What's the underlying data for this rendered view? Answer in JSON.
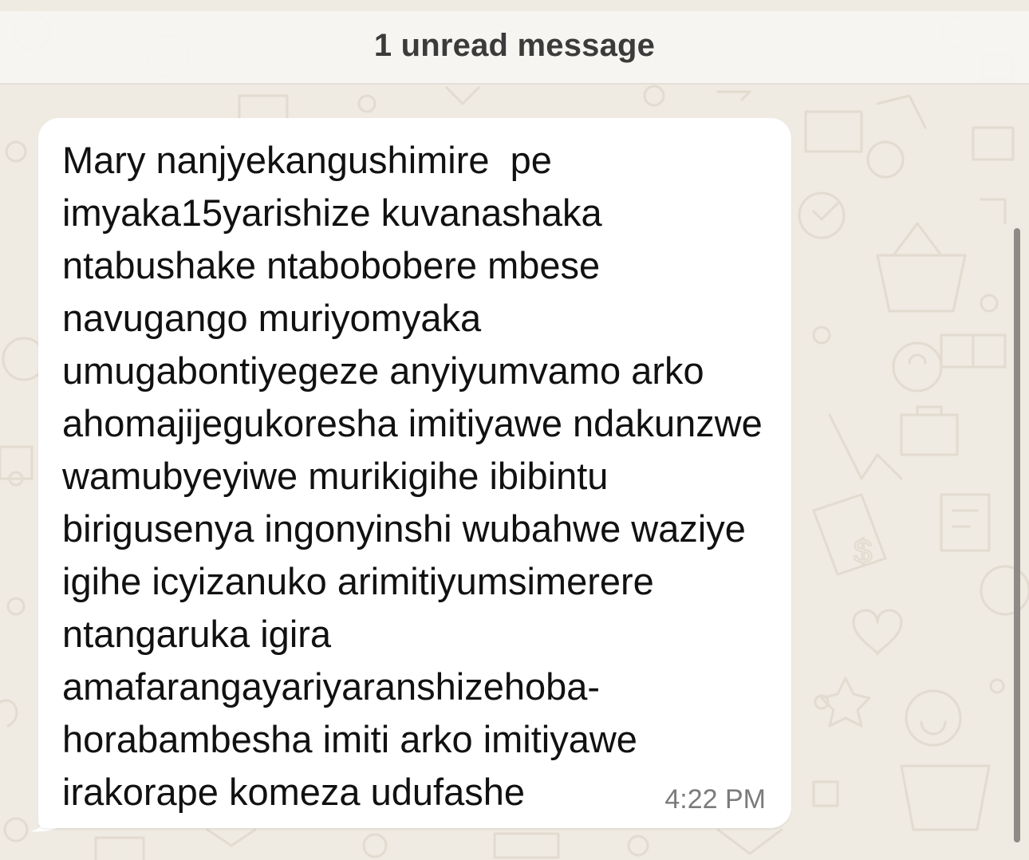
{
  "banner": {
    "unread_label": "1 unread message"
  },
  "message": {
    "text": "Mary nanjyekangushimire  pe imyaka15yarishize kuvanashaka ntabushake ntabobobere mbese navugango muriyomyaka umugabontiyegeze anyiyumvamo arko ahomajijegukoresha imitiyawe ndakunzwe wamubyeyiwe murikigihe ibibintu birigusenya ingonyinshi wubahwe waziye igihe icyizanuko arimitiyumsimerere ntangaruka igira amafarangayariyaranshizehoba-horabambesha imiti arko imitiyawe irakorape komeza udufashe",
    "time": "4:22 PM"
  },
  "colors": {
    "wallpaper": "#efeae2",
    "bubble": "#ffffff",
    "banner": "#f7f5f2",
    "timestamp": "#7b7b7b"
  },
  "icons": [
    "wallpaper-doodle-icons",
    "scrollbar-thumb"
  ]
}
